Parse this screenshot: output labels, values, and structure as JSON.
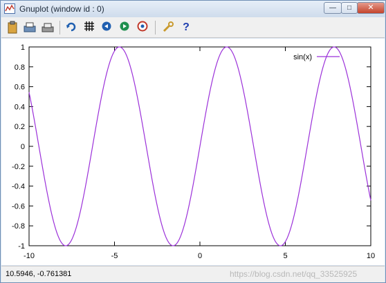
{
  "window": {
    "title": "Gnuplot (window id : 0)"
  },
  "title_buttons": {
    "minimize": "—",
    "maximize": "□",
    "close": "✕"
  },
  "toolbar": [
    {
      "name": "copy-clipboard-button",
      "icon": "📋"
    },
    {
      "name": "print-button",
      "icon": "🖨"
    },
    {
      "name": "print-setup-button",
      "icon": "🖶"
    },
    {
      "name": "replot-button",
      "icon": "↻"
    },
    {
      "name": "grid-button",
      "icon": "#"
    },
    {
      "name": "zoom-previous-button",
      "icon": "◀"
    },
    {
      "name": "zoom-next-button",
      "icon": "▶"
    },
    {
      "name": "autoscale-button",
      "icon": "⊕"
    },
    {
      "name": "options-button",
      "icon": "🔧"
    },
    {
      "name": "help-button",
      "icon": "?"
    }
  ],
  "status": {
    "coordinates": "10.5946, -0.761381",
    "watermark": "https://blog.csdn.net/qq_33525925"
  },
  "colors": {
    "curve": "#9b30d9",
    "axis": "#000000",
    "window_frame": "#d9e4f1"
  },
  "chart_data": {
    "type": "line",
    "title": "",
    "xlabel": "",
    "ylabel": "",
    "xlim": [
      -10,
      10
    ],
    "ylim": [
      -1,
      1
    ],
    "x_ticks": [
      "-10",
      "-5",
      "0",
      "5",
      "10"
    ],
    "y_ticks": [
      "1",
      "0.8",
      "0.6",
      "0.4",
      "0.2",
      "0",
      "-0.2",
      "-0.4",
      "-0.6",
      "-0.8",
      "-1"
    ],
    "grid": false,
    "legend_position": "top-right",
    "series": [
      {
        "name": "sin(x)",
        "function": "sin(x)"
      }
    ]
  }
}
